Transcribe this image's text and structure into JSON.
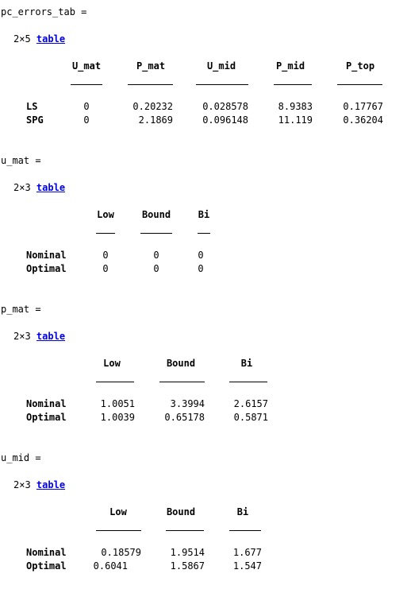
{
  "blocks": [
    {
      "assign": "pc_errors_tab =",
      "dims": "2×5",
      "link": "table",
      "columns": [
        "U_mat",
        "P_mat",
        "U_mid",
        "P_mid",
        "P_top"
      ],
      "rows": [
        {
          "name": "LS",
          "values": [
            "0",
            "0.20232",
            "0.028578",
            "8.9383",
            "0.17767"
          ]
        },
        {
          "name": "SPG",
          "values": [
            "0",
            "2.1869",
            "0.096148",
            "11.119",
            "0.36204"
          ]
        }
      ]
    },
    {
      "assign": "u_mat =",
      "dims": "2×3",
      "link": "table",
      "columns": [
        "Low",
        "Bound",
        "Bi"
      ],
      "rows": [
        {
          "name": "Nominal",
          "values": [
            "0",
            "0",
            "0"
          ]
        },
        {
          "name": "Optimal",
          "values": [
            "0",
            "0",
            "0"
          ]
        }
      ]
    },
    {
      "assign": "p_mat =",
      "dims": "2×3",
      "link": "table",
      "columns": [
        "Low",
        "Bound",
        "Bi"
      ],
      "rows": [
        {
          "name": "Nominal",
          "values": [
            "1.0051",
            "3.3994",
            "2.6157"
          ]
        },
        {
          "name": "Optimal",
          "values": [
            "1.0039",
            "0.65178",
            "0.5871"
          ]
        }
      ]
    },
    {
      "assign": "u_mid =",
      "dims": "2×3",
      "link": "table",
      "columns": [
        "Low",
        "Bound",
        "Bi"
      ],
      "rows": [
        {
          "name": "Nominal",
          "values": [
            "0.18579",
            "1.9514",
            "1.677"
          ]
        },
        {
          "name": "Optimal",
          "values": [
            "0.6041",
            "1.5867",
            "1.547"
          ]
        }
      ]
    }
  ]
}
